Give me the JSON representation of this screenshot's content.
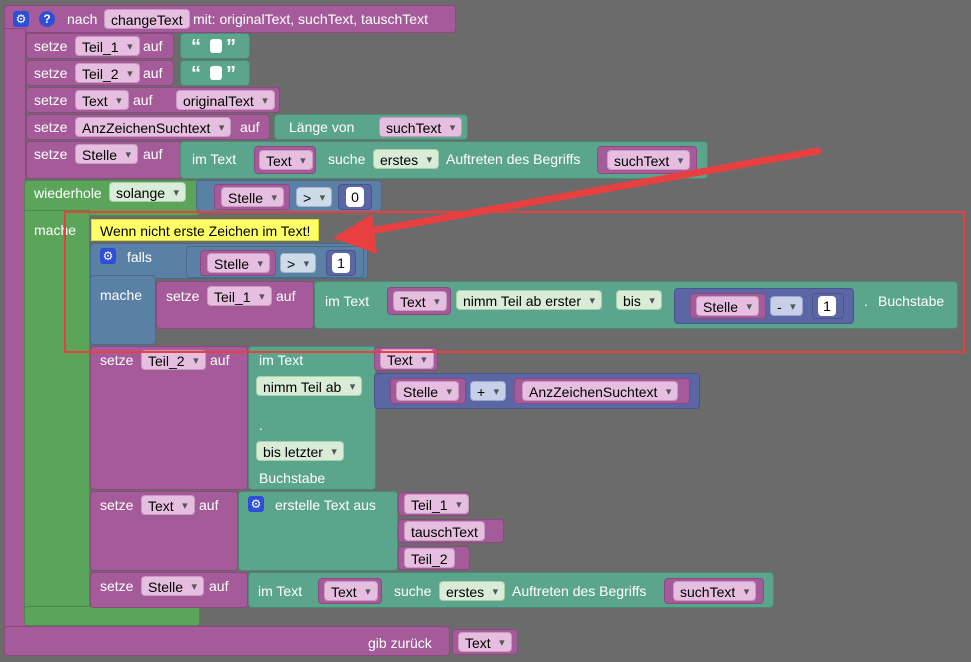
{
  "func": {
    "header_prefix": "nach",
    "name": "changeText",
    "params": "mit: originalText, suchText, tauschText",
    "return_label": "gib zurück",
    "return_var": "Text"
  },
  "kw": {
    "setze": "setze",
    "auf": "auf",
    "laenge_von": "Länge von",
    "im_text": "im Text",
    "suche": "suche",
    "erstes": "erstes",
    "auftreten": "Auftreten des Begriffs",
    "wiederhole": "wiederhole",
    "solange": "solange",
    "mache": "mache",
    "falls": "falls",
    "nimm_teil_ab_erster": "nimm Teil ab erster",
    "bis": "bis",
    "buchstabe": "Buchstabe",
    "nimm_teil_ab": "nimm Teil ab",
    "dot": ".",
    "bis_letzter": "bis letzter",
    "erstelle_text_aus": "erstelle Text aus",
    "gt": ">",
    "minus": "-",
    "plus": "+"
  },
  "vars": {
    "teil_1": "Teil_1",
    "teil_2": "Teil_2",
    "text": "Text",
    "original": "originalText",
    "anz": "AnzZeichenSuchtext",
    "such": "suchText",
    "stelle": "Stelle",
    "tausch": "tauschText"
  },
  "nums": {
    "zero": "0",
    "one": "1"
  },
  "comment": "Wenn nicht erste Zeichen im Text!"
}
